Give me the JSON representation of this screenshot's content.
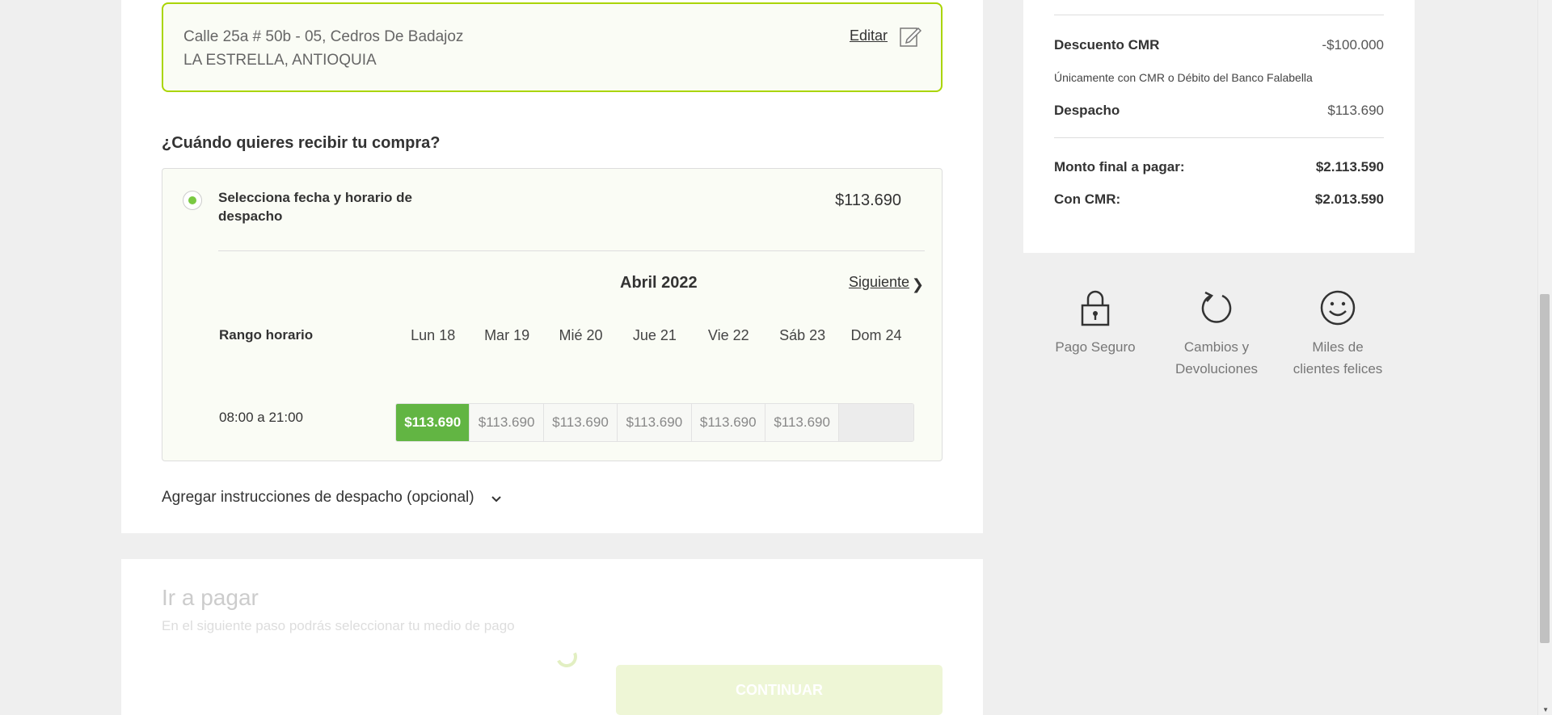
{
  "address": {
    "line1": "Calle 25a # 50b - 05, Cedros De Badajoz",
    "line2": "LA ESTRELLA, ANTIOQUIA",
    "edit_label": "Editar"
  },
  "delivery": {
    "question": "¿Cuándo quieres recibir tu compra?",
    "option_title": "Selecciona fecha y horario de despacho",
    "option_price": "$113.690",
    "month": "Abril 2022",
    "next_label": "Siguiente",
    "range_label": "Rango horario",
    "days": [
      "Lun 18",
      "Mar 19",
      "Mié 20",
      "Jue 21",
      "Vie 22",
      "Sáb 23",
      "Dom 24"
    ],
    "slot_time": "08:00 a 21:00",
    "slots": [
      "$113.690",
      "$113.690",
      "$113.690",
      "$113.690",
      "$113.690",
      "$113.690",
      ""
    ],
    "instructions_label": "Agregar instrucciones de despacho (opcional)"
  },
  "payment": {
    "title": "Ir a pagar",
    "subtitle": "En el siguiente paso podrás seleccionar tu medio de pago",
    "continue_label": "CONTINUAR"
  },
  "summary": {
    "discount_label": "Descuento CMR",
    "discount_value": "-$100.000",
    "discount_note": "Únicamente con CMR o Débito del Banco Falabella",
    "shipping_label": "Despacho",
    "shipping_value": "$113.690",
    "total_label": "Monto final a pagar:",
    "total_value": "$2.113.590",
    "cmr_label": "Con CMR:",
    "cmr_value": "$2.013.590"
  },
  "benefits": {
    "secure": [
      "Pago Seguro"
    ],
    "returns": [
      "Cambios y",
      "Devoluciones"
    ],
    "happy": [
      "Miles de",
      "clientes felices"
    ]
  },
  "colors": {
    "accent_green": "#62b543",
    "border_green": "#aad500",
    "button_disabled": "#eef6d6"
  }
}
